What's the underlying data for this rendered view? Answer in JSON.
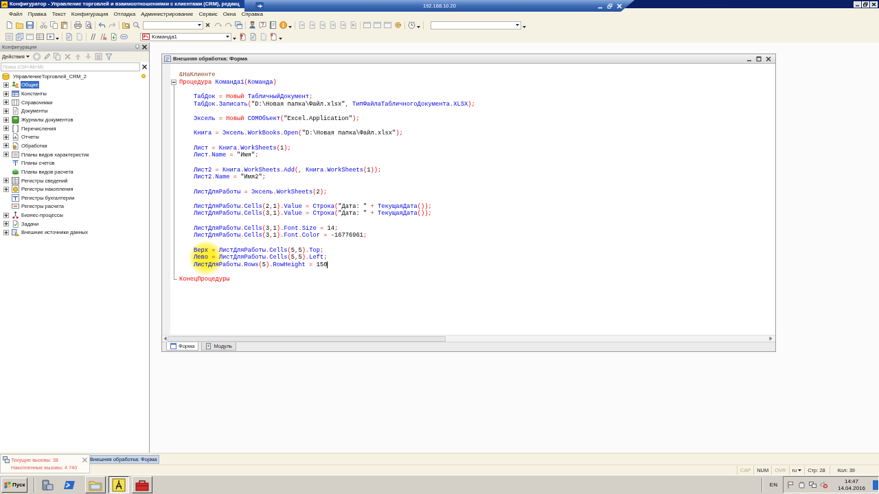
{
  "window": {
    "title": "Конфигуратор - Управление торговлей и взаимоотношениями с клиентами (CRM), редакц"
  },
  "remote_bar": {
    "title": "192.168.10.20"
  },
  "menu": [
    "Файл",
    "Правка",
    "Текст",
    "Конфигурация",
    "Отладка",
    "Администрирование",
    "Сервис",
    "Окна",
    "Справка"
  ],
  "toolbar": {
    "command_field": {
      "value": "Команда1"
    }
  },
  "config_panel": {
    "title": "Конфигурация",
    "actions": "Действия",
    "search": {
      "placeholder": "Поиск (Ctrl+Alt+M)"
    },
    "tree": [
      {
        "label": "УправлениеТорговлей_CRM_2",
        "selected": false,
        "children": [
          {
            "label": "Общие",
            "selected": true,
            "expanded": false
          },
          {
            "label": "Константы",
            "selected": false,
            "expanded": false
          },
          {
            "label": "Справочники",
            "selected": false,
            "expanded": false
          },
          {
            "label": "Документы",
            "selected": false,
            "expanded": false
          },
          {
            "label": "Журналы документов",
            "selected": false,
            "expanded": false
          },
          {
            "label": "Перечисления",
            "selected": false,
            "expanded": false
          },
          {
            "label": "Отчеты",
            "selected": false,
            "expanded": false
          },
          {
            "label": "Обработки",
            "selected": false,
            "expanded": false
          },
          {
            "label": "Планы видов характеристик",
            "selected": false,
            "expanded": false
          },
          {
            "label": "Планы счетов",
            "selected": false
          },
          {
            "label": "Планы видов расчета",
            "selected": false
          },
          {
            "label": "Регистры сведений",
            "selected": false,
            "expanded": false
          },
          {
            "label": "Регистры накопления",
            "selected": false,
            "expanded": false
          },
          {
            "label": "Регистры бухгалтерии",
            "selected": false
          },
          {
            "label": "Регистры расчета",
            "selected": false
          },
          {
            "label": "Бизнес-процессы",
            "selected": false,
            "expanded": false
          },
          {
            "label": "Задачи",
            "selected": false,
            "expanded": false
          },
          {
            "label": "Внешние источники данных",
            "selected": false,
            "expanded": false
          }
        ]
      }
    ]
  },
  "editor": {
    "title": "Внешняя обработка: Форма",
    "lines": [
      {
        "tokens": [
          {
            "text": "&НаКлиенте",
            "kind": "directive"
          }
        ],
        "caret": false
      },
      {
        "tokens": [
          {
            "text": "Процедура ",
            "kind": "keyword"
          },
          {
            "text": "Команда1",
            "kind": "identifier"
          },
          {
            "text": "(",
            "kind": "operator"
          },
          {
            "text": "Команда",
            "kind": "identifier"
          },
          {
            "text": ")",
            "kind": "operator"
          }
        ],
        "caret": false,
        "expanded": true,
        "children": [
          {
            "lines": [
              {
                "tokens": [
                  {
                    "text": "ТабДок",
                    "kind": "identifier"
                  },
                  {
                    "text": " = ",
                    "kind": "operator"
                  },
                  {
                    "text": "Новый ",
                    "kind": "keyword"
                  },
                  {
                    "text": "ТабличныйДокумент",
                    "kind": "identifier"
                  },
                  {
                    "text": ";",
                    "kind": "operator"
                  }
                ],
                "caret": false
              },
              {
                "tokens": [
                  {
                    "text": "ТабДок",
                    "kind": "identifier"
                  },
                  {
                    "text": ".",
                    "kind": "operator"
                  },
                  {
                    "text": "Записать",
                    "kind": "identifier"
                  },
                  {
                    "text": "(",
                    "kind": "operator"
                  },
                  {
                    "text": "\"D:\\Новая папка\\Файл.xlsx\"",
                    "kind": "string"
                  },
                  {
                    "text": ", ",
                    "kind": "operator"
                  },
                  {
                    "text": "ТипФайлаТабличногоДокумента",
                    "kind": "identifier"
                  },
                  {
                    "text": ".",
                    "kind": "operator"
                  },
                  {
                    "text": "XLSX",
                    "kind": "identifier"
                  },
                  {
                    "text": ");",
                    "kind": "operator"
                  }
                ],
                "caret": false
              }
            ]
          },
          {
            "lines": [
              {
                "tokens": [
                  {
                    "text": "Эксель",
                    "kind": "identifier"
                  },
                  {
                    "text": " = ",
                    "kind": "operator"
                  },
                  {
                    "text": "Новый ",
                    "kind": "keyword"
                  },
                  {
                    "text": "COMОбъект",
                    "kind": "identifier"
                  },
                  {
                    "text": "(",
                    "kind": "operator"
                  },
                  {
                    "text": "\"Excel.Application\"",
                    "kind": "string"
                  },
                  {
                    "text": ");",
                    "kind": "operator"
                  }
                ],
                "caret": false
              }
            ]
          },
          {
            "lines": [
              {
                "tokens": [
                  {
                    "text": "Книга",
                    "kind": "identifier"
                  },
                  {
                    "text": " = ",
                    "kind": "operator"
                  },
                  {
                    "text": "Эксель",
                    "kind": "identifier"
                  },
                  {
                    "text": ".",
                    "kind": "operator"
                  },
                  {
                    "text": "WorkBooks",
                    "kind": "identifier"
                  },
                  {
                    "text": ".",
                    "kind": "operator"
                  },
                  {
                    "text": "Open",
                    "kind": "identifier"
                  },
                  {
                    "text": "(",
                    "kind": "operator"
                  },
                  {
                    "text": "\"D:\\Новая папка\\Файл.xlsx\"",
                    "kind": "string"
                  },
                  {
                    "text": ");",
                    "kind": "operator"
                  }
                ],
                "caret": false
              }
            ]
          },
          {
            "lines": [
              {
                "tokens": [
                  {
                    "text": "Лист",
                    "kind": "identifier"
                  },
                  {
                    "text": " = ",
                    "kind": "operator"
                  },
                  {
                    "text": "Книга",
                    "kind": "identifier"
                  },
                  {
                    "text": ".",
                    "kind": "operator"
                  },
                  {
                    "text": "WorkSheets",
                    "kind": "identifier"
                  },
                  {
                    "text": "(",
                    "kind": "operator"
                  },
                  {
                    "text": "1",
                    "kind": "number"
                  },
                  {
                    "text": ");",
                    "kind": "operator"
                  }
                ],
                "caret": false
              },
              {
                "tokens": [
                  {
                    "text": "Лист",
                    "kind": "identifier"
                  },
                  {
                    "text": ".",
                    "kind": "operator"
                  },
                  {
                    "text": "Name",
                    "kind": "identifier"
                  },
                  {
                    "text": " = ",
                    "kind": "operator"
                  },
                  {
                    "text": "\"Имя\"",
                    "kind": "string"
                  },
                  {
                    "text": ";",
                    "kind": "operator"
                  }
                ],
                "caret": false
              }
            ]
          },
          {
            "lines": [
              {
                "tokens": [
                  {
                    "text": "Лист2",
                    "kind": "identifier"
                  },
                  {
                    "text": " = ",
                    "kind": "operator"
                  },
                  {
                    "text": "Книга",
                    "kind": "identifier"
                  },
                  {
                    "text": ".",
                    "kind": "operator"
                  },
                  {
                    "text": "WorkSheets",
                    "kind": "identifier"
                  },
                  {
                    "text": ".",
                    "kind": "operator"
                  },
                  {
                    "text": "Add",
                    "kind": "identifier"
                  },
                  {
                    "text": "(, ",
                    "kind": "operator"
                  },
                  {
                    "text": "Книга",
                    "kind": "identifier"
                  },
                  {
                    "text": ".",
                    "kind": "operator"
                  },
                  {
                    "text": "WorkSheets",
                    "kind": "identifier"
                  },
                  {
                    "text": "(",
                    "kind": "operator"
                  },
                  {
                    "text": "1",
                    "kind": "number"
                  },
                  {
                    "text": "));",
                    "kind": "operator"
                  }
                ],
                "caret": false
              },
              {
                "tokens": [
                  {
                    "text": "Лист2",
                    "kind": "identifier"
                  },
                  {
                    "text": ".",
                    "kind": "operator"
                  },
                  {
                    "text": "Name",
                    "kind": "identifier"
                  },
                  {
                    "text": " = ",
                    "kind": "operator"
                  },
                  {
                    "text": "\"Имя2\"",
                    "kind": "string"
                  },
                  {
                    "text": ";",
                    "kind": "operator"
                  }
                ],
                "caret": false
              }
            ]
          },
          {
            "lines": [
              {
                "tokens": [
                  {
                    "text": "ЛистДляРаботы",
                    "kind": "identifier"
                  },
                  {
                    "text": " = ",
                    "kind": "operator"
                  },
                  {
                    "text": "Эксель",
                    "kind": "identifier"
                  },
                  {
                    "text": ".",
                    "kind": "operator"
                  },
                  {
                    "text": "WorkSheets",
                    "kind": "identifier"
                  },
                  {
                    "text": "(",
                    "kind": "operator"
                  },
                  {
                    "text": "2",
                    "kind": "number"
                  },
                  {
                    "text": ");",
                    "kind": "operator"
                  }
                ],
                "caret": false
              }
            ]
          },
          {
            "lines": [
              {
                "tokens": [
                  {
                    "text": "ЛистДляРаботы",
                    "kind": "identifier"
                  },
                  {
                    "text": ".",
                    "kind": "operator"
                  },
                  {
                    "text": "Cells",
                    "kind": "identifier"
                  },
                  {
                    "text": "(",
                    "kind": "operator"
                  },
                  {
                    "text": "2",
                    "kind": "number"
                  },
                  {
                    "text": ",",
                    "kind": "operator"
                  },
                  {
                    "text": "1",
                    "kind": "number"
                  },
                  {
                    "text": ").",
                    "kind": "operator"
                  },
                  {
                    "text": "Value",
                    "kind": "identifier"
                  },
                  {
                    "text": " = ",
                    "kind": "operator"
                  },
                  {
                    "text": "Строка",
                    "kind": "identifier"
                  },
                  {
                    "text": "(",
                    "kind": "operator"
                  },
                  {
                    "text": "\"Дата: \"",
                    "kind": "string"
                  },
                  {
                    "text": " + ",
                    "kind": "operator"
                  },
                  {
                    "text": "ТекущаяДата",
                    "kind": "identifier"
                  },
                  {
                    "text": "());",
                    "kind": "operator"
                  }
                ],
                "caret": false
              },
              {
                "tokens": [
                  {
                    "text": "ЛистДляРаботы",
                    "kind": "identifier"
                  },
                  {
                    "text": ".",
                    "kind": "operator"
                  },
                  {
                    "text": "Cells",
                    "kind": "identifier"
                  },
                  {
                    "text": "(",
                    "kind": "operator"
                  },
                  {
                    "text": "3",
                    "kind": "number"
                  },
                  {
                    "text": ",",
                    "kind": "operator"
                  },
                  {
                    "text": "1",
                    "kind": "number"
                  },
                  {
                    "text": ").",
                    "kind": "operator"
                  },
                  {
                    "text": "Value",
                    "kind": "identifier"
                  },
                  {
                    "text": " = ",
                    "kind": "operator"
                  },
                  {
                    "text": "Строка",
                    "kind": "identifier"
                  },
                  {
                    "text": "(",
                    "kind": "operator"
                  },
                  {
                    "text": "\"Дата: \"",
                    "kind": "string"
                  },
                  {
                    "text": " + ",
                    "kind": "operator"
                  },
                  {
                    "text": "ТекущаяДата",
                    "kind": "identifier"
                  },
                  {
                    "text": "());",
                    "kind": "operator"
                  }
                ],
                "caret": false
              }
            ]
          },
          {
            "lines": [
              {
                "tokens": [
                  {
                    "text": "ЛистДляРаботы",
                    "kind": "identifier"
                  },
                  {
                    "text": ".",
                    "kind": "operator"
                  },
                  {
                    "text": "Cells",
                    "kind": "identifier"
                  },
                  {
                    "text": "(",
                    "kind": "operator"
                  },
                  {
                    "text": "3",
                    "kind": "number"
                  },
                  {
                    "text": ",",
                    "kind": "operator"
                  },
                  {
                    "text": "1",
                    "kind": "number"
                  },
                  {
                    "text": ").",
                    "kind": "operator"
                  },
                  {
                    "text": "Font",
                    "kind": "identifier"
                  },
                  {
                    "text": ".",
                    "kind": "operator"
                  },
                  {
                    "text": "Size",
                    "kind": "identifier"
                  },
                  {
                    "text": " = ",
                    "kind": "operator"
                  },
                  {
                    "text": "14",
                    "kind": "number"
                  },
                  {
                    "text": ";",
                    "kind": "operator"
                  }
                ],
                "caret": false
              },
              {
                "tokens": [
                  {
                    "text": "ЛистДляРаботы",
                    "kind": "identifier"
                  },
                  {
                    "text": ".",
                    "kind": "operator"
                  },
                  {
                    "text": "Cells",
                    "kind": "identifier"
                  },
                  {
                    "text": "(",
                    "kind": "operator"
                  },
                  {
                    "text": "3",
                    "kind": "number"
                  },
                  {
                    "text": ",",
                    "kind": "operator"
                  },
                  {
                    "text": "1",
                    "kind": "number"
                  },
                  {
                    "text": ").",
                    "kind": "operator"
                  },
                  {
                    "text": "Font",
                    "kind": "identifier"
                  },
                  {
                    "text": ".",
                    "kind": "operator"
                  },
                  {
                    "text": "Color",
                    "kind": "identifier"
                  },
                  {
                    "text": " = ",
                    "kind": "operator"
                  },
                  {
                    "text": "-16776961",
                    "kind": "number"
                  },
                  {
                    "text": ";",
                    "kind": "operator"
                  }
                ],
                "caret": false
              }
            ]
          },
          {
            "lines": [
              {
                "tokens": [
                  {
                    "text": "Верх",
                    "kind": "identifier"
                  },
                  {
                    "text": " = ",
                    "kind": "operator"
                  },
                  {
                    "text": "ЛистДляРаботы",
                    "kind": "identifier"
                  },
                  {
                    "text": ".",
                    "kind": "operator"
                  },
                  {
                    "text": "Cells",
                    "kind": "identifier"
                  },
                  {
                    "text": "(",
                    "kind": "operator"
                  },
                  {
                    "text": "5",
                    "kind": "number"
                  },
                  {
                    "text": ",",
                    "kind": "operator"
                  },
                  {
                    "text": "5",
                    "kind": "number"
                  },
                  {
                    "text": ").",
                    "kind": "operator"
                  },
                  {
                    "text": "Top",
                    "kind": "identifier"
                  },
                  {
                    "text": ";",
                    "kind": "operator"
                  }
                ],
                "caret": false
              },
              {
                "tokens": [
                  {
                    "text": "Лево",
                    "kind": "identifier"
                  },
                  {
                    "text": " = ",
                    "kind": "operator"
                  },
                  {
                    "text": "ЛистДляРаботы",
                    "kind": "identifier"
                  },
                  {
                    "text": ".",
                    "kind": "operator"
                  },
                  {
                    "text": "Cells",
                    "kind": "identifier"
                  },
                  {
                    "text": "(",
                    "kind": "operator"
                  },
                  {
                    "text": "5",
                    "kind": "number"
                  },
                  {
                    "text": ",",
                    "kind": "operator"
                  },
                  {
                    "text": "5",
                    "kind": "number"
                  },
                  {
                    "text": ").",
                    "kind": "operator"
                  },
                  {
                    "text": "Left",
                    "kind": "identifier"
                  },
                  {
                    "text": ";",
                    "kind": "operator"
                  }
                ],
                "caret": false
              },
              {
                "tokens": [
                  {
                    "text": "ЛистДляРаботы",
                    "kind": "identifier"
                  },
                  {
                    "text": ".",
                    "kind": "operator"
                  },
                  {
                    "text": "Rows",
                    "kind": "identifier"
                  },
                  {
                    "text": "(",
                    "kind": "operator"
                  },
                  {
                    "text": "5",
                    "kind": "number"
                  },
                  {
                    "text": ").",
                    "kind": "operator"
                  },
                  {
                    "text": "RowHeight",
                    "kind": "identifier"
                  },
                  {
                    "text": " = ",
                    "kind": "operator"
                  },
                  {
                    "text": "150",
                    "kind": "number"
                  }
                ],
                "caret": true
              }
            ]
          }
        ],
        "end": {
          "tokens": [
            {
              "text": "КонецПроцедуры",
              "kind": "keyword"
            }
          ],
          "caret": false
        }
      }
    ],
    "tabs": [
      {
        "label": "Форма",
        "selected": true
      },
      {
        "label": "Модуль",
        "selected": false
      }
    ]
  },
  "window_tabs": [
    {
      "label": "Внешняя обработка: Форма",
      "selected": true
    }
  ],
  "notification": {
    "lines": [
      "Текущие вызовы: 38",
      "Накопленные вызовы: 4 740"
    ]
  },
  "status_bar": {
    "indicators": [
      {
        "label": "CAP",
        "on": false
      },
      {
        "label": "NUM",
        "on": true
      },
      {
        "label": "OVR",
        "on": false
      }
    ],
    "language": "ru",
    "line": "Стр: 28",
    "column": "Кол: 39"
  },
  "taskbar": {
    "start": "Пуск",
    "apps": [
      {
        "selected": false
      },
      {
        "selected": true
      },
      {
        "selected": false
      }
    ],
    "language": "EN",
    "time": "14:47",
    "date": "14.04.2016"
  }
}
